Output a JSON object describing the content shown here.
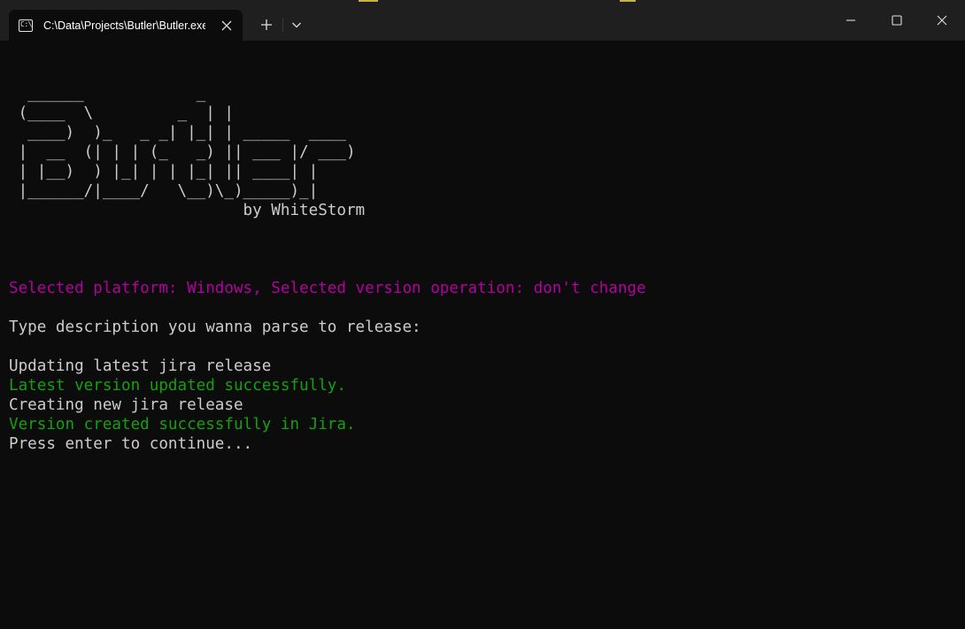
{
  "window": {
    "tab_title": "C:\\Data\\Projects\\Butler\\Butler.exe",
    "tab_icon": "terminal-icon",
    "buttons": [
      "new-tab-icon",
      "chevron-down-icon",
      "minimize-icon",
      "maximize-icon",
      "close-icon"
    ]
  },
  "colors": {
    "accent_top": "#c7b14a",
    "background": "#0c0c0c",
    "text": "#cccccc",
    "magenta": "#b4009e",
    "green": "#13a10e"
  },
  "terminal": {
    "lines": [
      {
        "text": "",
        "color": "default"
      },
      {
        "text": "",
        "color": "default"
      },
      {
        "text": "  ______            _",
        "color": "default"
      },
      {
        "text": " (____  \\         _  | |",
        "color": "default"
      },
      {
        "text": "  ____)  )_   _ _| |_| | _____  ____",
        "color": "default"
      },
      {
        "text": " |  __  (| | | (_   _) || ___ |/ ___)",
        "color": "default"
      },
      {
        "text": " | |__)  ) |_| | | |_| || ____| |",
        "color": "default"
      },
      {
        "text": " |______/|____/   \\__)\\_)_____)_|",
        "color": "default"
      },
      {
        "text": "                         by WhiteStorm",
        "color": "default"
      },
      {
        "text": "",
        "color": "default"
      },
      {
        "text": "",
        "color": "default"
      },
      {
        "text": "",
        "color": "default"
      },
      {
        "text": "Selected platform: Windows, Selected version operation: don't change",
        "color": "magenta"
      },
      {
        "text": "",
        "color": "default"
      },
      {
        "text": "Type description you wanna parse to release:",
        "color": "default"
      },
      {
        "text": "",
        "color": "default"
      },
      {
        "text": "Updating latest jira release",
        "color": "default"
      },
      {
        "text": "Latest version updated successfully.",
        "color": "green"
      },
      {
        "text": "Creating new jira release",
        "color": "default"
      },
      {
        "text": "Version created successfully in Jira.",
        "color": "green"
      },
      {
        "text": "Press enter to continue...",
        "color": "default"
      }
    ]
  }
}
